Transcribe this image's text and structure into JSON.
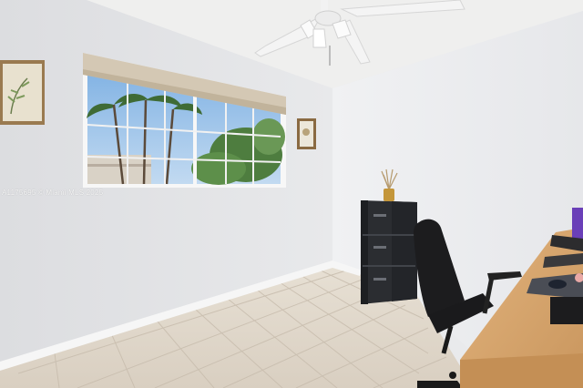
{
  "photo": {
    "watermark": "A1175695 © Miami MLS 2025"
  },
  "palette": {
    "wall_left": "#e4e5e7",
    "wall_right": "#eeeff1",
    "ceiling": "#f0f0ef",
    "floor": "#ddd4c7",
    "cabinet": "#2b2d31",
    "desk": "#d7a56c",
    "sky": "#9cc3ea"
  }
}
